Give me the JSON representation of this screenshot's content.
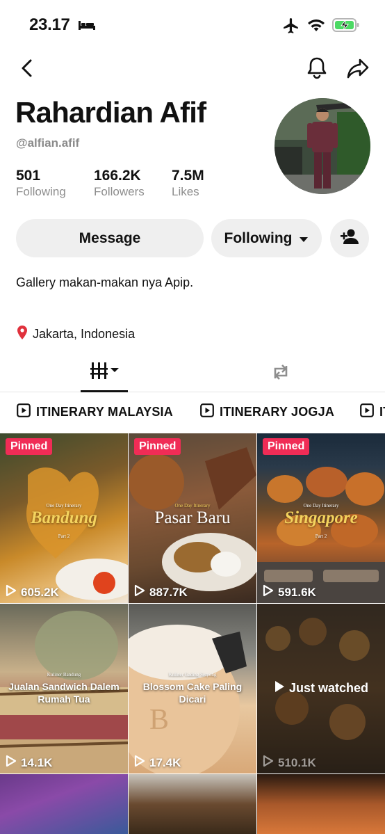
{
  "status_bar": {
    "time": "23.17",
    "icons": [
      "bed-icon",
      "airplane-icon",
      "wifi-icon",
      "battery-charging-icon"
    ],
    "battery_color": "#4cd964"
  },
  "nav": {
    "icons": [
      "back-icon",
      "bell-icon",
      "share-icon"
    ]
  },
  "profile": {
    "name": "Rahardian Afif",
    "handle": "@alfian.afif",
    "stats": [
      {
        "value": "501",
        "label": "Following"
      },
      {
        "value": "166.2K",
        "label": "Followers"
      },
      {
        "value": "7.5M",
        "label": "Likes"
      }
    ],
    "buttons": {
      "message": "Message",
      "following": "Following"
    },
    "bio": "Gallery makan-makan nya Apip.",
    "location": "Jakarta, Indonesia"
  },
  "tabs": {
    "icons": [
      "videos-grid-icon",
      "reposts-icon"
    ],
    "active": "videos"
  },
  "playlists": [
    {
      "label": "ITINERARY MALAYSIA"
    },
    {
      "label": "ITINERARY JOGJA"
    },
    {
      "label": "IT"
    }
  ],
  "videos": [
    {
      "pinned": "Pinned",
      "views": "605.2K",
      "overlay_small": "One Day Itinerary",
      "overlay_title": "Bandung",
      "overlay_sub": "Part 2"
    },
    {
      "pinned": "Pinned",
      "views": "887.7K",
      "overlay_small": "One Day Itinerary",
      "overlay_title": "Pasar Baru"
    },
    {
      "pinned": "Pinned",
      "views": "591.6K",
      "overlay_small": "One Day Itinerary",
      "overlay_title": "Singapore",
      "overlay_sub": "Part 2"
    },
    {
      "views": "14.1K",
      "overlay_small": "Kuliner Bandung",
      "overlay_caption": "Jualan Sandwich Dalem Rumah Tua"
    },
    {
      "views": "17.4K",
      "overlay_small": "Kuliner Gading Serpong",
      "overlay_caption": "Blossom Cake Paling Dicari"
    },
    {
      "views": "510.1K",
      "just_watched": "Just watched"
    }
  ],
  "colors": {
    "pinned_badge": "#f02c56",
    "button_bg": "#efefef",
    "muted_text": "#8e8e8e"
  }
}
